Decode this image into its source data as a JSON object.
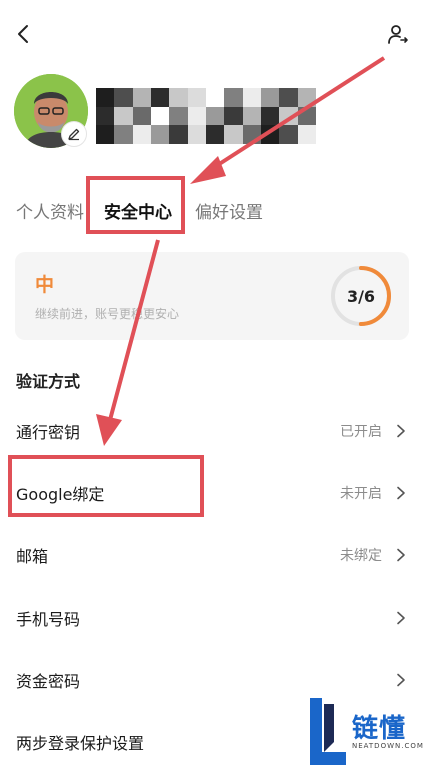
{
  "header": {
    "back_icon": "chevron-left-icon",
    "account_icon": "account-switch-icon"
  },
  "profile": {
    "avatar": "user-avatar",
    "edit_icon": "pencil-icon",
    "name_obscured": true
  },
  "tabs": [
    {
      "label": "个人资料",
      "active": false
    },
    {
      "label": "安全中心",
      "active": true
    },
    {
      "label": "偏好设置",
      "active": false
    }
  ],
  "security_score": {
    "level": "中",
    "description": "继续前进，账号更稳更安心",
    "progress_label": "3/6",
    "progress_fraction": 0.5,
    "accent_color": "#f08a3a"
  },
  "verification": {
    "title": "验证方式",
    "items": [
      {
        "label": "通行密钥",
        "status": "已开启"
      },
      {
        "label": "Google绑定",
        "status": "未开启"
      },
      {
        "label": "邮箱",
        "status": "未绑定"
      },
      {
        "label": "手机号码",
        "status": ""
      },
      {
        "label": "资金密码",
        "status": ""
      },
      {
        "label": "两步登录保护设置",
        "status": ""
      }
    ]
  },
  "annotation": {
    "highlight_color": "#e05057"
  },
  "watermark": {
    "text": "链懂",
    "sub": "NEATDOWN.COM"
  }
}
